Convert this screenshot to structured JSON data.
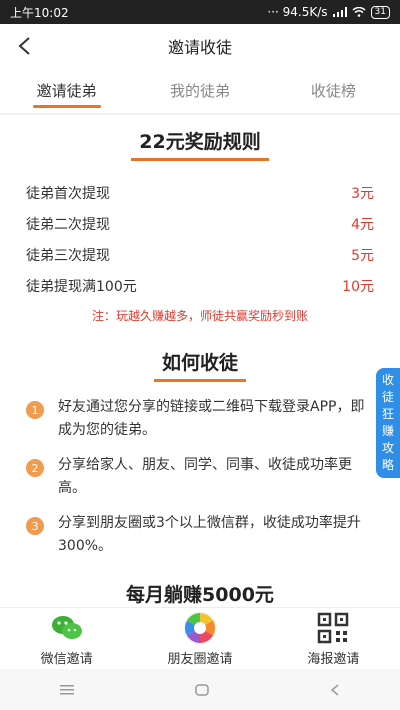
{
  "status": {
    "time": "上午10:02",
    "net": "··· 94.5K/s",
    "battery": "31"
  },
  "header": {
    "title": "邀请收徒"
  },
  "tabs": [
    {
      "label": "邀请徒弟",
      "active": true
    },
    {
      "label": "我的徒弟",
      "active": false
    },
    {
      "label": "收徒榜",
      "active": false
    }
  ],
  "rules": {
    "title": "22元奖励规则",
    "rows": [
      {
        "label": "徒弟首次提现",
        "amount": "3元"
      },
      {
        "label": "徒弟二次提现",
        "amount": "4元"
      },
      {
        "label": "徒弟三次提现",
        "amount": "5元"
      },
      {
        "label": "徒弟提现满100元",
        "amount": "10元"
      }
    ],
    "note": "注：玩越久赚越多，师徒共赢奖励秒到账"
  },
  "howto": {
    "title": "如何收徒",
    "steps": [
      {
        "num": "1",
        "text": "好友通过您分享的链接或二维码下载登录APP，即成为您的徒弟。"
      },
      {
        "num": "2",
        "text": "分享给家人、朋友、同学、同事、收徒成功率更高。"
      },
      {
        "num": "3",
        "text": "分享到朋友圈或3个以上微信群，收徒成功率提升300%。"
      }
    ]
  },
  "monthly": {
    "title": "每月躺赚5000元"
  },
  "side_tab": {
    "chars": [
      "收",
      "徒",
      "狂",
      "赚",
      "攻",
      "略"
    ]
  },
  "bottom": {
    "wechat": "微信邀请",
    "moments": "朋友圈邀请",
    "poster": "海报邀请"
  },
  "colors": {
    "accent": "#e8732b",
    "amount": "#e03a2f",
    "side_tab": "#2f8fe8"
  }
}
